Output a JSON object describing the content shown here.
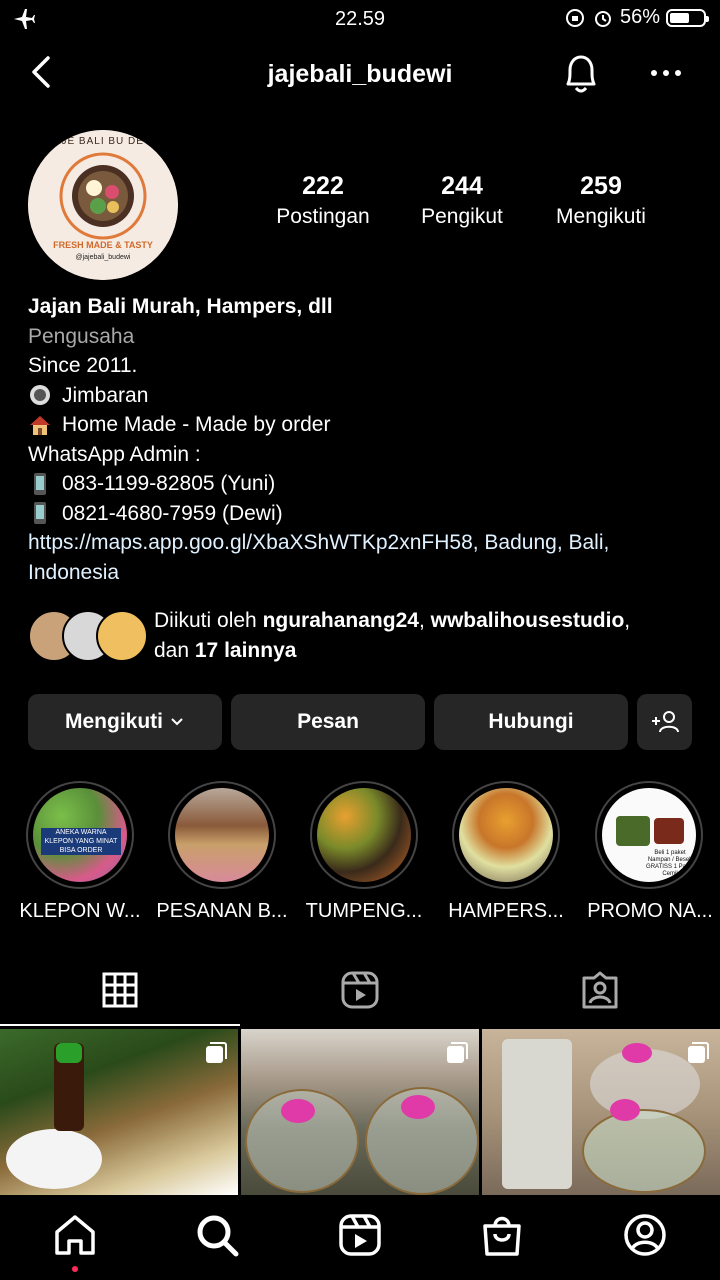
{
  "status_bar": {
    "time": "22.59",
    "battery": "56%"
  },
  "header": {
    "username": "jajebali_budewi"
  },
  "avatar": {
    "logo_top": "JAJE BALI BU DEWI",
    "logo_bottom": "FRESH MADE & TASTY",
    "handle": "@jajebali_budewi"
  },
  "stats": [
    {
      "value": "222",
      "label": "Postingan"
    },
    {
      "value": "244",
      "label": "Pengikut"
    },
    {
      "value": "259",
      "label": "Mengikuti"
    }
  ],
  "bio": {
    "name": "Jajan Bali Murah, Hampers, dll",
    "category": "Pengusaha",
    "lines": [
      "Since 2011.",
      "Jimbaran",
      "Home Made - Made by order",
      "WhatsApp Admin :",
      "083-1199-82805 (Yuni)",
      "0821-4680-7959 (Dewi)"
    ],
    "link": "https://maps.app.goo.gl/XbaXShWTKp2xnFH58, Badung, Bali, Indonesia"
  },
  "followed_by": {
    "prefix": "Diikuti oleh ",
    "user1": "ngurahanang24",
    "sep": ", ",
    "user2": "wwbalihousestudio",
    "mid": ",",
    "and": "dan ",
    "others": "17 lainnya"
  },
  "buttons": {
    "following": "Mengikuti",
    "message": "Pesan",
    "contact": "Hubungi"
  },
  "highlights": [
    {
      "label": "KLEPON W...",
      "overlay": "ANEKA WARNA KLEPON YANG MINAT BISA ORDER"
    },
    {
      "label": "PESANAN B..."
    },
    {
      "label": "TUMPENG..."
    },
    {
      "label": "HAMPERS..."
    },
    {
      "label": "PROMO NA...",
      "overlay": "Beli 1 paket Nampan / Besek GRATISS 1 Paket Cemil"
    }
  ],
  "icons": [
    "airplane-icon",
    "back-icon",
    "bell-icon",
    "more-icon",
    "grid-icon",
    "reels-icon",
    "tagged-icon",
    "home-icon",
    "search-icon",
    "shop-icon",
    "profile-icon",
    "add-person-icon"
  ]
}
